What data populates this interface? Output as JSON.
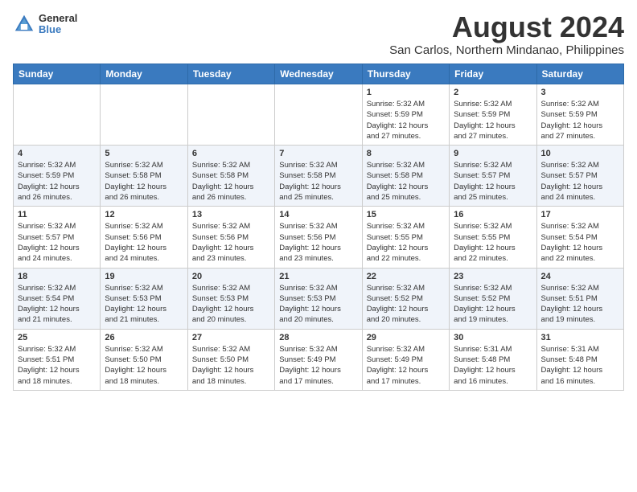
{
  "logo": {
    "general": "General",
    "blue": "Blue"
  },
  "title": "August 2024",
  "subtitle": "San Carlos, Northern Mindanao, Philippines",
  "days_header": [
    "Sunday",
    "Monday",
    "Tuesday",
    "Wednesday",
    "Thursday",
    "Friday",
    "Saturday"
  ],
  "weeks": [
    [
      {
        "day": "",
        "info": ""
      },
      {
        "day": "",
        "info": ""
      },
      {
        "day": "",
        "info": ""
      },
      {
        "day": "",
        "info": ""
      },
      {
        "day": "1",
        "info": "Sunrise: 5:32 AM\nSunset: 5:59 PM\nDaylight: 12 hours\nand 27 minutes."
      },
      {
        "day": "2",
        "info": "Sunrise: 5:32 AM\nSunset: 5:59 PM\nDaylight: 12 hours\nand 27 minutes."
      },
      {
        "day": "3",
        "info": "Sunrise: 5:32 AM\nSunset: 5:59 PM\nDaylight: 12 hours\nand 27 minutes."
      }
    ],
    [
      {
        "day": "4",
        "info": "Sunrise: 5:32 AM\nSunset: 5:59 PM\nDaylight: 12 hours\nand 26 minutes."
      },
      {
        "day": "5",
        "info": "Sunrise: 5:32 AM\nSunset: 5:58 PM\nDaylight: 12 hours\nand 26 minutes."
      },
      {
        "day": "6",
        "info": "Sunrise: 5:32 AM\nSunset: 5:58 PM\nDaylight: 12 hours\nand 26 minutes."
      },
      {
        "day": "7",
        "info": "Sunrise: 5:32 AM\nSunset: 5:58 PM\nDaylight: 12 hours\nand 25 minutes."
      },
      {
        "day": "8",
        "info": "Sunrise: 5:32 AM\nSunset: 5:58 PM\nDaylight: 12 hours\nand 25 minutes."
      },
      {
        "day": "9",
        "info": "Sunrise: 5:32 AM\nSunset: 5:57 PM\nDaylight: 12 hours\nand 25 minutes."
      },
      {
        "day": "10",
        "info": "Sunrise: 5:32 AM\nSunset: 5:57 PM\nDaylight: 12 hours\nand 24 minutes."
      }
    ],
    [
      {
        "day": "11",
        "info": "Sunrise: 5:32 AM\nSunset: 5:57 PM\nDaylight: 12 hours\nand 24 minutes."
      },
      {
        "day": "12",
        "info": "Sunrise: 5:32 AM\nSunset: 5:56 PM\nDaylight: 12 hours\nand 24 minutes."
      },
      {
        "day": "13",
        "info": "Sunrise: 5:32 AM\nSunset: 5:56 PM\nDaylight: 12 hours\nand 23 minutes."
      },
      {
        "day": "14",
        "info": "Sunrise: 5:32 AM\nSunset: 5:56 PM\nDaylight: 12 hours\nand 23 minutes."
      },
      {
        "day": "15",
        "info": "Sunrise: 5:32 AM\nSunset: 5:55 PM\nDaylight: 12 hours\nand 22 minutes."
      },
      {
        "day": "16",
        "info": "Sunrise: 5:32 AM\nSunset: 5:55 PM\nDaylight: 12 hours\nand 22 minutes."
      },
      {
        "day": "17",
        "info": "Sunrise: 5:32 AM\nSunset: 5:54 PM\nDaylight: 12 hours\nand 22 minutes."
      }
    ],
    [
      {
        "day": "18",
        "info": "Sunrise: 5:32 AM\nSunset: 5:54 PM\nDaylight: 12 hours\nand 21 minutes."
      },
      {
        "day": "19",
        "info": "Sunrise: 5:32 AM\nSunset: 5:53 PM\nDaylight: 12 hours\nand 21 minutes."
      },
      {
        "day": "20",
        "info": "Sunrise: 5:32 AM\nSunset: 5:53 PM\nDaylight: 12 hours\nand 20 minutes."
      },
      {
        "day": "21",
        "info": "Sunrise: 5:32 AM\nSunset: 5:53 PM\nDaylight: 12 hours\nand 20 minutes."
      },
      {
        "day": "22",
        "info": "Sunrise: 5:32 AM\nSunset: 5:52 PM\nDaylight: 12 hours\nand 20 minutes."
      },
      {
        "day": "23",
        "info": "Sunrise: 5:32 AM\nSunset: 5:52 PM\nDaylight: 12 hours\nand 19 minutes."
      },
      {
        "day": "24",
        "info": "Sunrise: 5:32 AM\nSunset: 5:51 PM\nDaylight: 12 hours\nand 19 minutes."
      }
    ],
    [
      {
        "day": "25",
        "info": "Sunrise: 5:32 AM\nSunset: 5:51 PM\nDaylight: 12 hours\nand 18 minutes."
      },
      {
        "day": "26",
        "info": "Sunrise: 5:32 AM\nSunset: 5:50 PM\nDaylight: 12 hours\nand 18 minutes."
      },
      {
        "day": "27",
        "info": "Sunrise: 5:32 AM\nSunset: 5:50 PM\nDaylight: 12 hours\nand 18 minutes."
      },
      {
        "day": "28",
        "info": "Sunrise: 5:32 AM\nSunset: 5:49 PM\nDaylight: 12 hours\nand 17 minutes."
      },
      {
        "day": "29",
        "info": "Sunrise: 5:32 AM\nSunset: 5:49 PM\nDaylight: 12 hours\nand 17 minutes."
      },
      {
        "day": "30",
        "info": "Sunrise: 5:31 AM\nSunset: 5:48 PM\nDaylight: 12 hours\nand 16 minutes."
      },
      {
        "day": "31",
        "info": "Sunrise: 5:31 AM\nSunset: 5:48 PM\nDaylight: 12 hours\nand 16 minutes."
      }
    ]
  ]
}
